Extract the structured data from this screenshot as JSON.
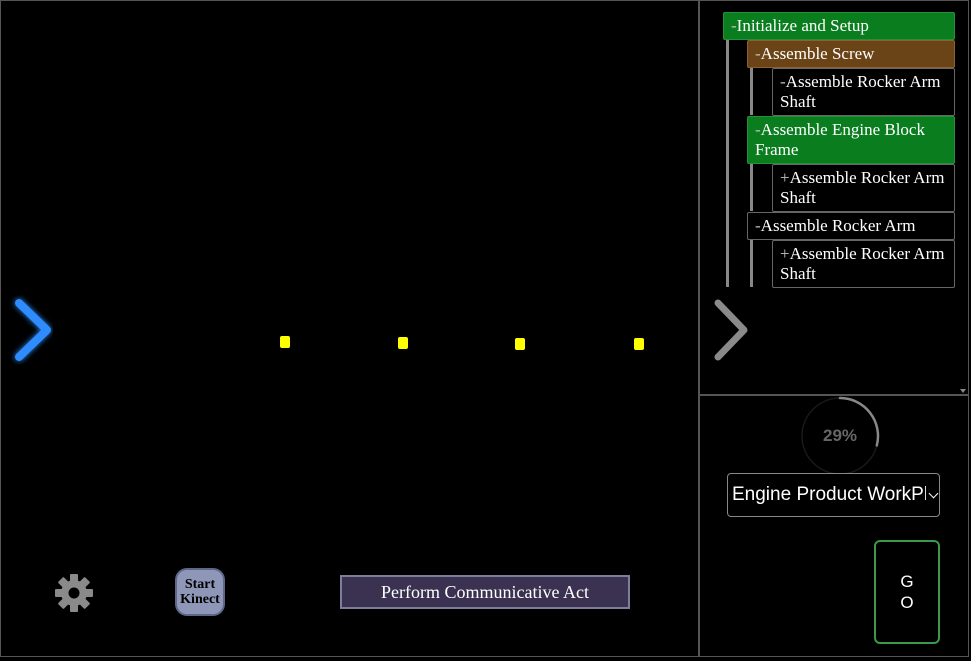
{
  "main": {
    "kinect_button_label": "Start Kinect",
    "communicate_button_label": "Perform Communicative Act",
    "settings_icon": "gear-icon",
    "left_nav_icon": "chevron-right-icon",
    "marker_color": "#ffff00"
  },
  "task_tree": {
    "nodes": [
      {
        "toggle": "-",
        "label": "Initialize and Setup",
        "status": "active"
      },
      {
        "toggle": "-",
        "label": "Assemble Screw",
        "status": "in-progress"
      },
      {
        "toggle": "-",
        "label": "Assemble Rocker Arm Shaft",
        "status": "pending"
      },
      {
        "toggle": "-",
        "label": "Assemble Engine Block Frame",
        "status": "active"
      },
      {
        "toggle": "+",
        "label": "Assemble Rocker Arm Shaft",
        "status": "pending"
      },
      {
        "toggle": "-",
        "label": "Assemble Rocker Arm",
        "status": "pending"
      },
      {
        "toggle": "+",
        "label": "Assemble Rocker Arm Shaft",
        "status": "pending"
      }
    ],
    "colors": {
      "active": "#0a7d1f",
      "in_progress": "#6a4416",
      "pending": "#000000"
    }
  },
  "controls": {
    "progress_text": "29%",
    "progress_value": 0.29,
    "workplan_selected": "Engine Product WorkPlan",
    "go_label": "G O"
  }
}
